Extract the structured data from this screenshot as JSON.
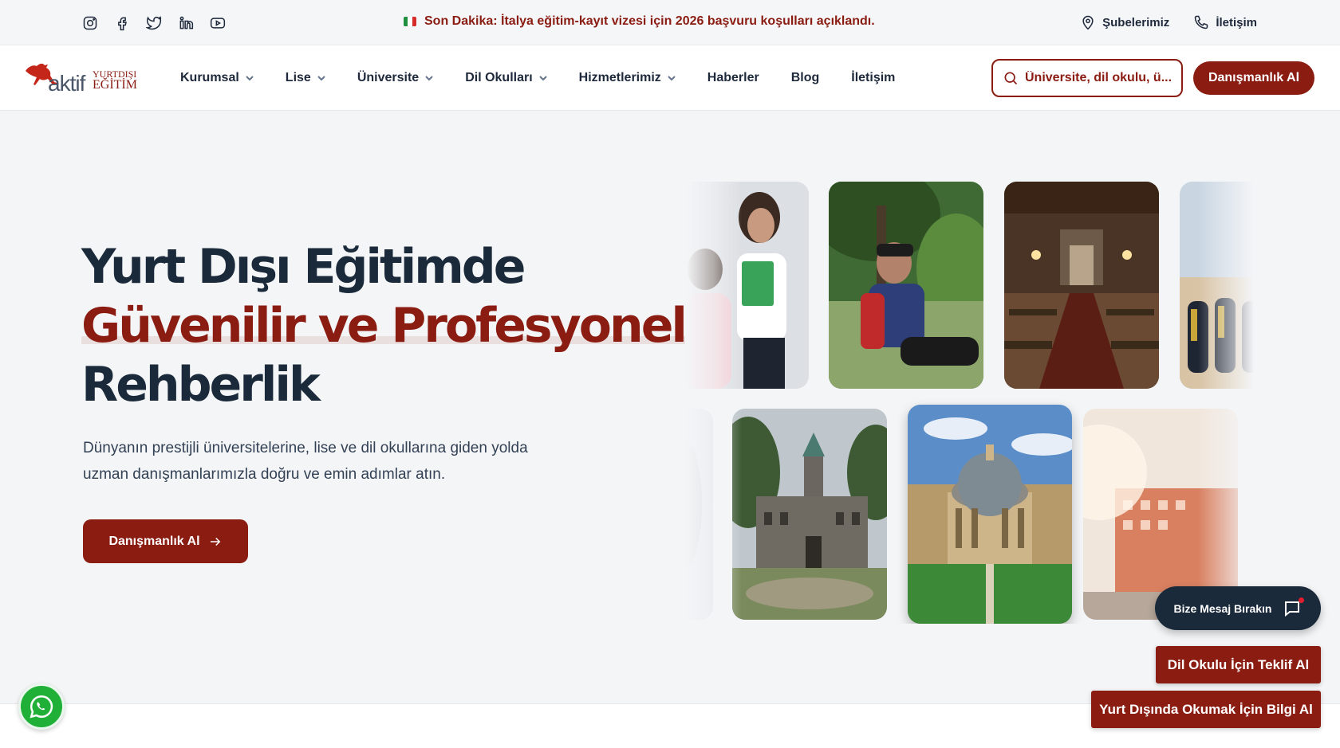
{
  "topbar": {
    "social_icons": [
      "instagram-icon",
      "facebook-icon",
      "twitter-icon",
      "linkedin-icon",
      "youtube-icon"
    ],
    "breaking_news": "Son Dakika: İtalya eğitim-kayıt vizesi için 2026 başvuru koşulları açıklandı.",
    "branches_label": "Şubelerimiz",
    "contact_label": "İletişim"
  },
  "header": {
    "logo": {
      "word": "aktif",
      "line1": "YURTDIŞI",
      "line2": "EĞİTİM"
    },
    "nav": [
      {
        "label": "Kurumsal",
        "dropdown": true
      },
      {
        "label": "Lise",
        "dropdown": true
      },
      {
        "label": "Üniversite",
        "dropdown": true
      },
      {
        "label": "Dil Okulları",
        "dropdown": true
      },
      {
        "label": "Hizmetlerimiz",
        "dropdown": true
      },
      {
        "label": "Haberler",
        "dropdown": false
      },
      {
        "label": "Blog",
        "dropdown": false
      },
      {
        "label": "İletişim",
        "dropdown": false
      }
    ],
    "search_placeholder": "Üniversite, dil okulu, ü...",
    "cta_label": "Danışmanlık Al"
  },
  "hero": {
    "title_line1": "Yurt Dışı Eğitimde",
    "title_line2": "Güvenilir ve Profesyonel",
    "title_line3": "Rehberlik",
    "description": "Dünyanın prestijli üniversitelerine, lise ve dil okullarına giden yolda uzman danışmanlarımızla doğru ve emin adımlar atın.",
    "button_label": "Danışmanlık Al"
  },
  "floating": {
    "message_label": "Bize Mesaj Bırakın",
    "language_school_label": "Dil Okulu İçin Teklif Al",
    "study_abroad_label": "Yurt Dışında Okumak İçin Bilgi Al"
  },
  "colors": {
    "brand": "#8a1c12",
    "dark": "#1b2a3a",
    "whatsapp": "#20b038"
  }
}
